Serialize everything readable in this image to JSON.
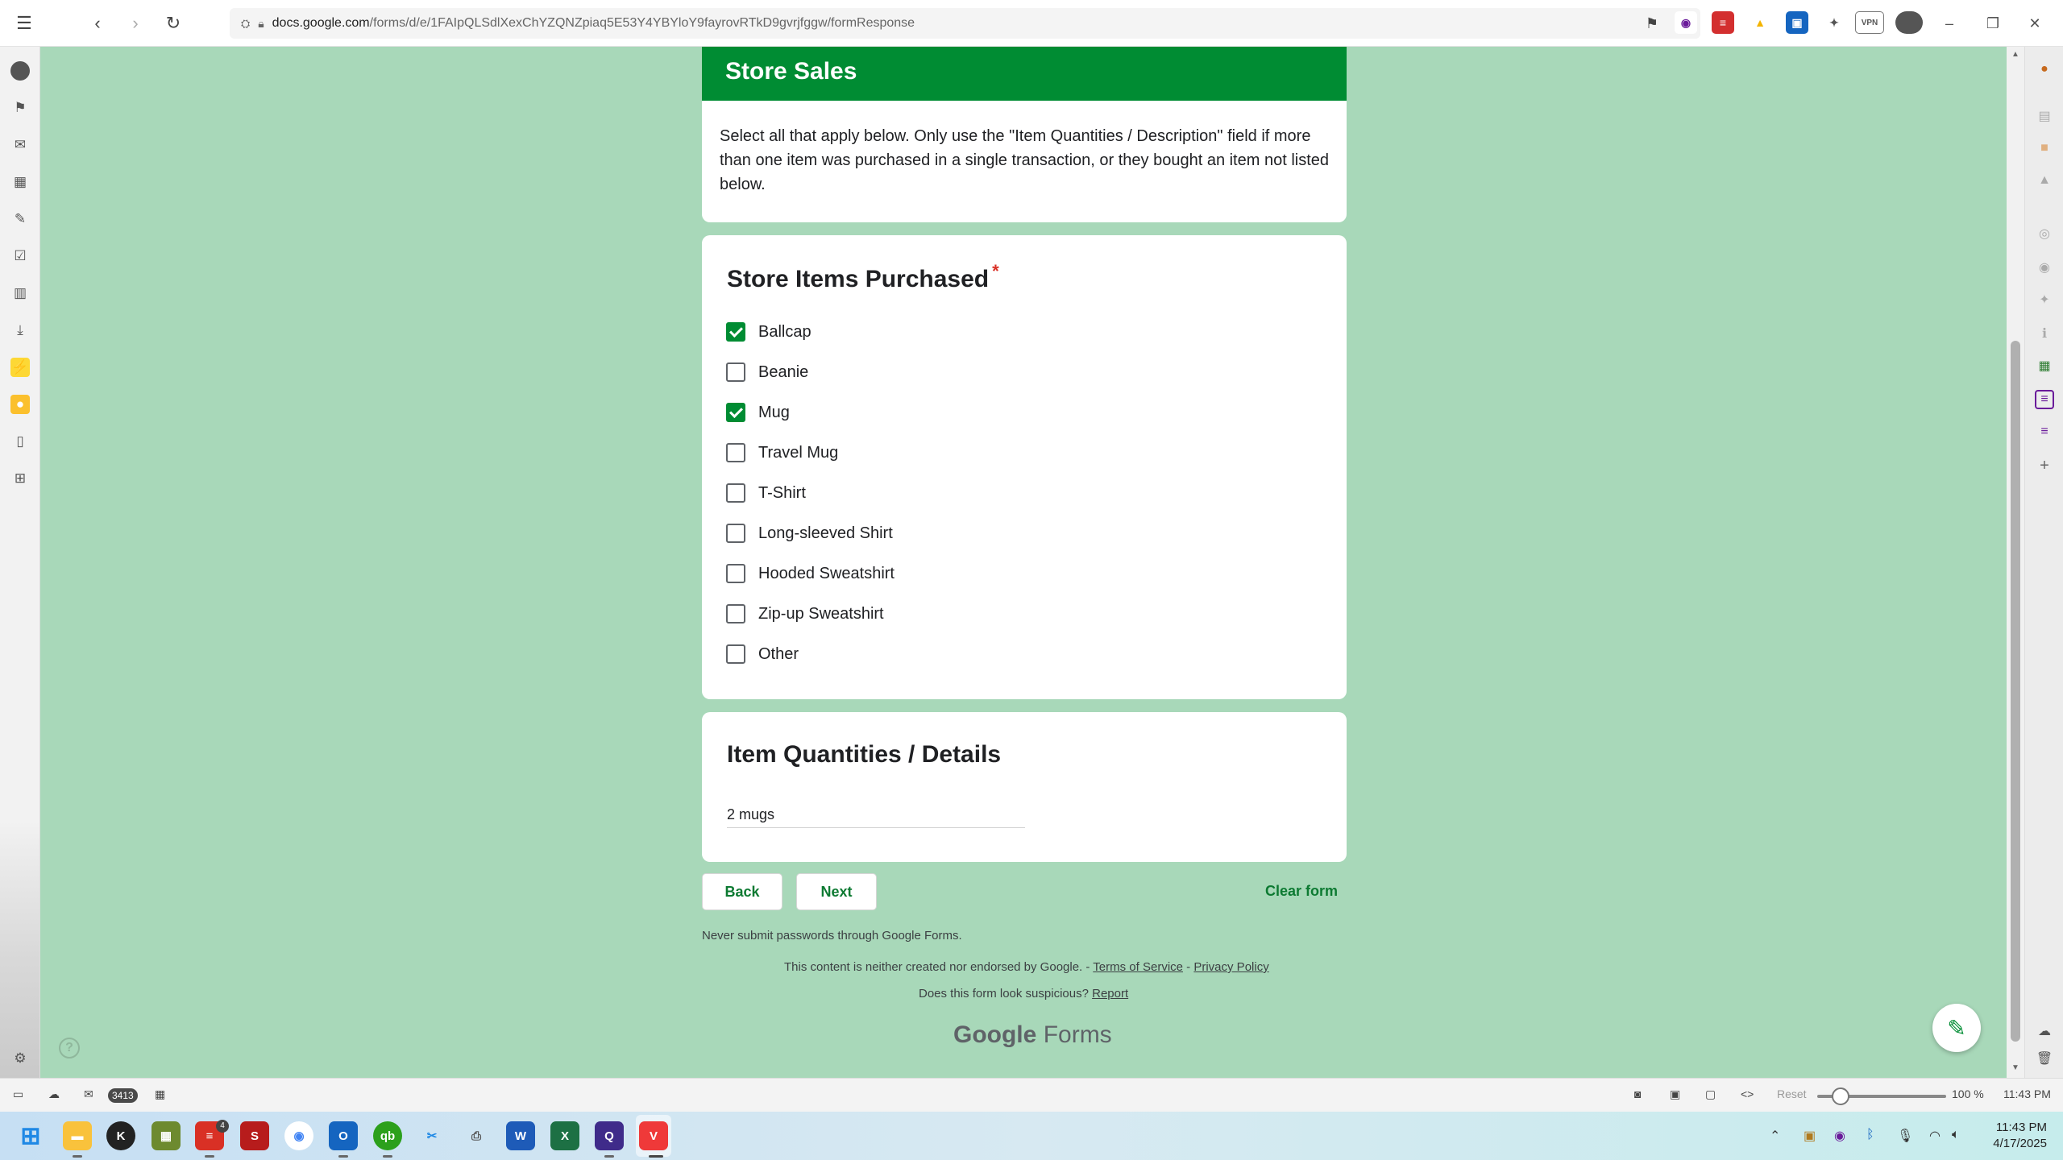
{
  "browser": {
    "url_host": "docs.google.com",
    "url_path": "/forms/d/e/1FAIpQLSdlXexChYZQNZpiaq5E53Y4YBYloY9fayrovRTkD9gvrjfggw/formResponse"
  },
  "form": {
    "section_title": "Store Sales",
    "section_description": "Select all that apply below. Only use the \"Item Quantities / Description\" field if more than one item was purchased in a single transaction, or they bought an item not listed below.",
    "question_title": "Store Items Purchased",
    "required_mark": "*",
    "options": [
      {
        "label": "Ballcap",
        "checked": true
      },
      {
        "label": "Beanie",
        "checked": false
      },
      {
        "label": "Mug",
        "checked": true
      },
      {
        "label": "Travel Mug",
        "checked": false
      },
      {
        "label": "T-Shirt",
        "checked": false
      },
      {
        "label": "Long-sleeved Shirt",
        "checked": false
      },
      {
        "label": "Hooded Sweatshirt",
        "checked": false
      },
      {
        "label": "Zip-up Sweatshirt",
        "checked": false
      },
      {
        "label": "Other",
        "checked": false
      }
    ],
    "details_title": "Item Quantities / Details",
    "details_value": "2 mugs",
    "back_label": "Back",
    "next_label": "Next",
    "clear_label": "Clear form"
  },
  "footer": {
    "passwords_warning": "Never submit passwords through Google Forms.",
    "disclaimer": "This content is neither created nor endorsed by Google. -",
    "terms": "Terms of Service",
    "separator": "-",
    "privacy": "Privacy Policy",
    "suspicious": "Does this form look suspicious?",
    "report": "Report",
    "brand_google": "Google",
    "brand_forms": "Forms"
  },
  "statusbar": {
    "mail_count": "3413",
    "reset_label": "Reset",
    "zoom": "100 %",
    "time": "11:43 PM"
  },
  "taskbar": {
    "clock_time": "11:43 PM",
    "clock_date": "4/17/2025",
    "todo_badge": "4"
  },
  "colors": {
    "page_bg": "#a8d8b9",
    "accent": "#008c33",
    "link": "#0d7a32"
  }
}
